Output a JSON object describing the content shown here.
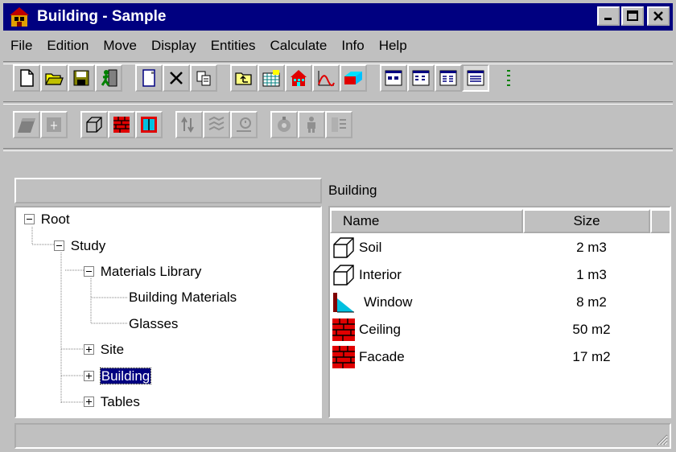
{
  "window": {
    "title": "Building - Sample"
  },
  "window_buttons": {
    "minimize": "minimize",
    "maximize": "maximize",
    "close": "close"
  },
  "menu": [
    "File",
    "Edition",
    "Move",
    "Display",
    "Entities",
    "Calculate",
    "Info",
    "Help"
  ],
  "toolbar1": [
    "new-icon",
    "open-icon",
    "save-icon",
    "exit-icon",
    "properties-icon",
    "delete-icon",
    "copy-icon",
    "up-folder-icon",
    "building-grid-icon",
    "house-icon",
    "curve-icon",
    "brick-icon",
    "view-large-icon",
    "view-small-icon",
    "view-list-icon",
    "view-details-icon"
  ],
  "toolbar2": [
    "wall-icon",
    "door-icon",
    "cube-icon",
    "brick-wall-icon",
    "window-icon",
    "move-icon",
    "pattern-icon",
    "rotate-icon",
    "calc-icon",
    "person-icon",
    "tools-icon"
  ],
  "left_panel": {
    "header": ""
  },
  "tree": [
    {
      "label": "Root",
      "expander": "minus"
    },
    {
      "label": "Study",
      "expander": "minus"
    },
    {
      "label": "Materials Library",
      "expander": "minus"
    },
    {
      "label": "Building Materials",
      "expander": "none"
    },
    {
      "label": "Glasses",
      "expander": "none"
    },
    {
      "label": "Site",
      "expander": "plus"
    },
    {
      "label": "Building",
      "expander": "plus",
      "selected": true
    },
    {
      "label": "Tables",
      "expander": "plus"
    }
  ],
  "right_panel": {
    "header": "Building"
  },
  "list": {
    "columns": [
      "Name",
      "Size"
    ],
    "rows": [
      {
        "name": "Soil",
        "size": "2 m3",
        "icon": "cube-outline-icon"
      },
      {
        "name": "Interior",
        "size": "1 m3",
        "icon": "cube-outline-icon"
      },
      {
        "name": "Window",
        "size": "8 m2",
        "icon": "window-triangle-icon"
      },
      {
        "name": "Ceiling",
        "size": "50 m2",
        "icon": "brick-icon"
      },
      {
        "name": "Facade",
        "size": "17 m2",
        "icon": "brick-icon"
      }
    ]
  },
  "status": {
    "text": ""
  },
  "colors": {
    "titlebar": "#000080",
    "face": "#c0c0c0",
    "brick": "#e00000",
    "selection": "#000080"
  }
}
